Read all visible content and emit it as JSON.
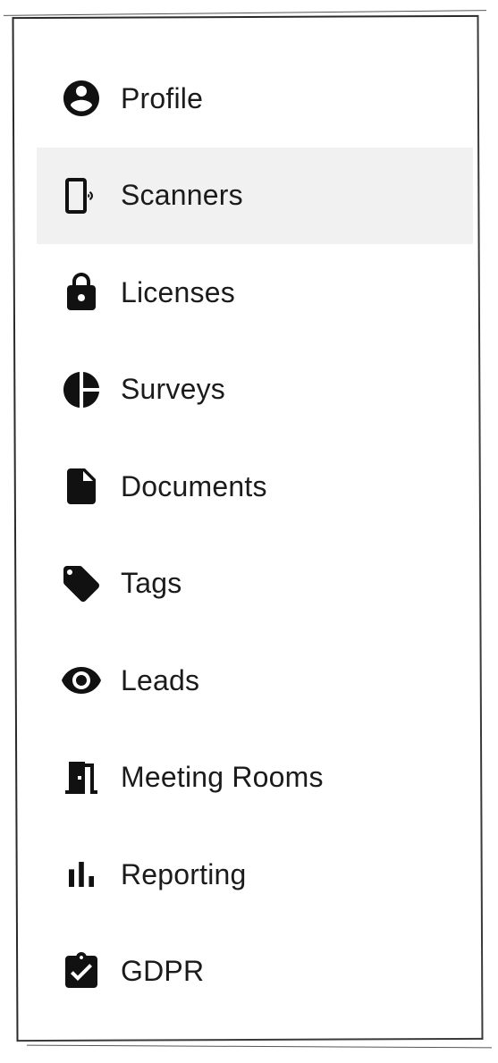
{
  "menu": {
    "items": [
      {
        "label": "Profile",
        "icon": "account-circle-icon",
        "active": false
      },
      {
        "label": "Scanners",
        "icon": "phone-nfc-icon",
        "active": true
      },
      {
        "label": "Licenses",
        "icon": "lock-icon",
        "active": false
      },
      {
        "label": "Surveys",
        "icon": "pie-chart-icon",
        "active": false
      },
      {
        "label": "Documents",
        "icon": "document-icon",
        "active": false
      },
      {
        "label": "Tags",
        "icon": "tag-icon",
        "active": false
      },
      {
        "label": "Leads",
        "icon": "eye-icon",
        "active": false
      },
      {
        "label": "Meeting Rooms",
        "icon": "door-icon",
        "active": false
      },
      {
        "label": "Reporting",
        "icon": "bar-chart-icon",
        "active": false
      },
      {
        "label": "GDPR",
        "icon": "clipboard-check-icon",
        "active": false
      }
    ]
  },
  "colors": {
    "active_background": "#f1f1f1",
    "icon": "#111111",
    "text": "#1b1b1b"
  }
}
